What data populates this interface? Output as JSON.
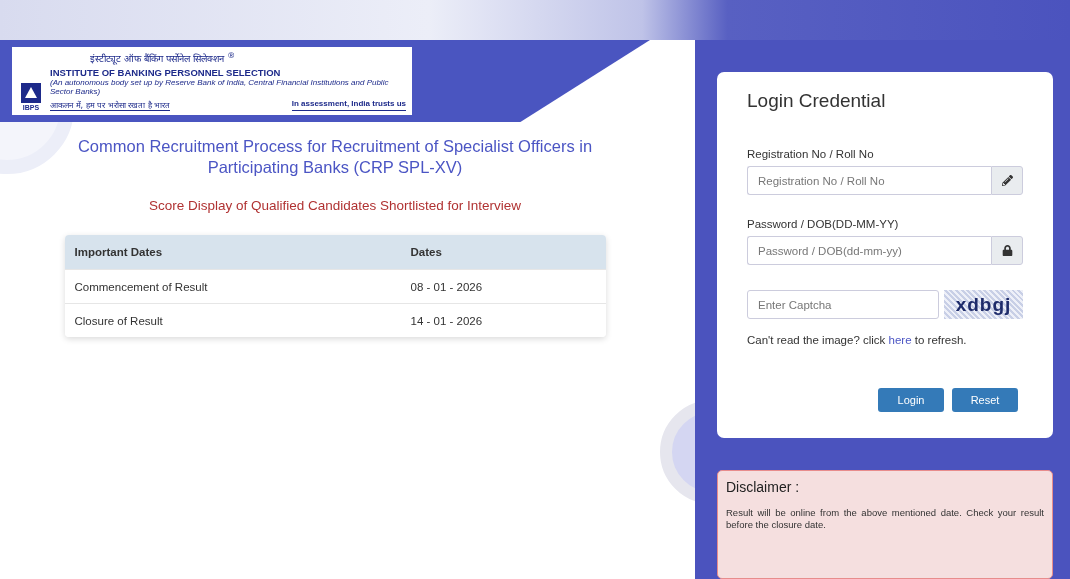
{
  "header": {
    "logo": {
      "hindi_name": "इंस्टीट्यूट ऑफ बैंकिंग पर्सोनेल सिलेक्शन",
      "registered_mark": "®",
      "english_name": "INSTITUTE OF BANKING PERSONNEL SELECTION",
      "subtitle": "(An autonomous body set up by Reserve Bank of India, Central Financial Institutions and Public Sector Banks)",
      "abbreviation": "IBPS",
      "hindi_tagline": "आकलन में, हम पर भरोसा रखता है भारत",
      "english_tagline": "In assessment, India trusts us"
    }
  },
  "main": {
    "title": "Common Recruitment Process for Recruitment of Specialist Officers in Participating Banks (CRP SPL-XV)",
    "subtitle": "Score Display of Qualified Candidates Shortlisted for Interview",
    "dates_table": {
      "columns": [
        "Important Dates",
        "Dates"
      ],
      "rows": [
        [
          "Commencement of Result",
          "08 - 01 - 2026"
        ],
        [
          "Closure of Result",
          "14 - 01 - 2026"
        ]
      ]
    }
  },
  "login": {
    "title": "Login Credential",
    "fields": [
      {
        "kind": "text",
        "label": "Registration No / Roll No",
        "placeholder": "Registration No / Roll No"
      },
      {
        "kind": "password",
        "label": "Password / DOB(DD-MM-YY)",
        "placeholder": "Password / DOB(dd-mm-yy)"
      },
      {
        "kind": "captcha",
        "placeholder": "Enter Captcha",
        "captcha_text": "xdbgj"
      }
    ],
    "refresh_hint": {
      "before": "Can't read the image? click",
      "link": "here",
      "after": "to refresh."
    },
    "buttons": [
      "Login",
      "Reset"
    ]
  },
  "disclaimer": {
    "title": "Disclaimer :",
    "text": "Result will be online from the above mentioned date. Check your result before the closure date."
  }
}
